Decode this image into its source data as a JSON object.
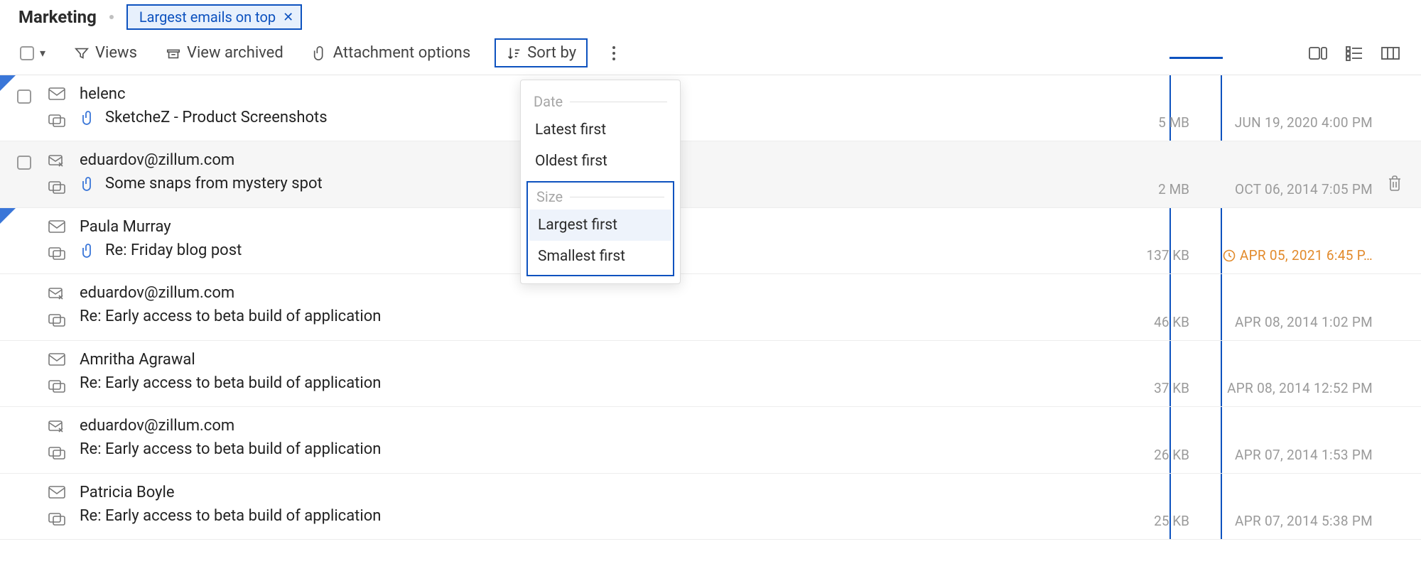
{
  "header": {
    "folder_name": "Marketing",
    "chip_label": "Largest emails on top"
  },
  "toolbar": {
    "views": "Views",
    "view_archived": "View archived",
    "attachment_options": "Attachment options",
    "sort_by": "Sort by"
  },
  "sort_menu": {
    "group_date": "Date",
    "latest_first": "Latest first",
    "oldest_first": "Oldest first",
    "group_size": "Size",
    "largest_first": "Largest first",
    "smallest_first": "Smallest first"
  },
  "emails": [
    {
      "sender": "helenc",
      "subject": "SketcheZ - Product Screenshots",
      "size": "5 MB",
      "date": "JUN 19, 2020 4:00 PM",
      "has_clip": true,
      "is_shared": false,
      "snoozed": false
    },
    {
      "sender": "eduardov@zillum.com",
      "subject": "Some snaps from mystery spot",
      "size": "2 MB",
      "date": "OCT 06, 2014 7:05 PM",
      "has_clip": true,
      "is_shared": true,
      "snoozed": false
    },
    {
      "sender": "Paula Murray",
      "subject": "Re: Friday blog post",
      "size": "137 KB",
      "date": "APR 05, 2021 6:45 P…",
      "has_clip": true,
      "is_shared": false,
      "snoozed": true
    },
    {
      "sender": "eduardov@zillum.com",
      "subject": "Re: Early access to beta build of application",
      "size": "46 KB",
      "date": "APR 08, 2014 1:02 PM",
      "has_clip": false,
      "is_shared": true,
      "snoozed": false
    },
    {
      "sender": "Amritha Agrawal",
      "subject": "Re: Early access to beta build of application",
      "size": "37 KB",
      "date": "APR 08, 2014 12:52 PM",
      "has_clip": false,
      "is_shared": false,
      "snoozed": false
    },
    {
      "sender": "eduardov@zillum.com",
      "subject": "Re: Early access to beta build of application",
      "size": "26 KB",
      "date": "APR 07, 2014 1:53 PM",
      "has_clip": false,
      "is_shared": true,
      "snoozed": false
    },
    {
      "sender": "Patricia Boyle",
      "subject": "Re: Early access to beta build of application",
      "size": "25 KB",
      "date": "APR 07, 2014 5:38 PM",
      "has_clip": false,
      "is_shared": false,
      "snoozed": false
    }
  ]
}
